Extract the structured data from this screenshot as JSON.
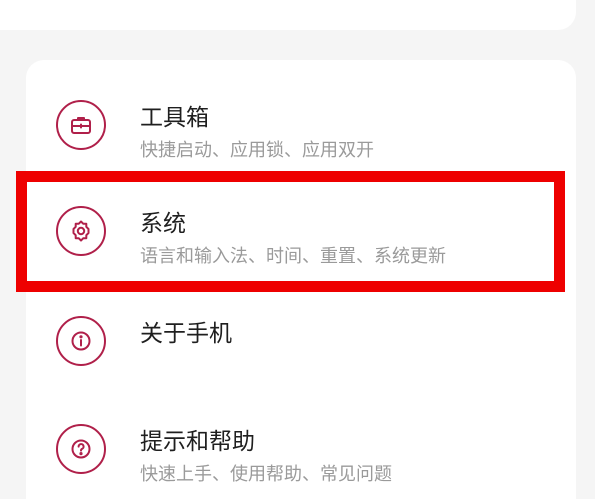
{
  "settings": {
    "items": [
      {
        "title": "工具箱",
        "subtitle": "快捷启动、应用锁、应用双开",
        "icon": "toolbox-icon"
      },
      {
        "title": "系统",
        "subtitle": "语言和输入法、时间、重置、系统更新",
        "icon": "gear-icon"
      },
      {
        "title": "关于手机",
        "subtitle": "",
        "icon": "info-icon"
      },
      {
        "title": "提示和帮助",
        "subtitle": "快速上手、使用帮助、常见问题",
        "icon": "help-icon"
      }
    ]
  },
  "colors": {
    "accent": "#b0204a",
    "highlight": "#ee0000",
    "background": "#f5f5f5",
    "card": "#ffffff",
    "title_text": "#1f1f1f",
    "subtitle_text": "#9a9a9a"
  }
}
